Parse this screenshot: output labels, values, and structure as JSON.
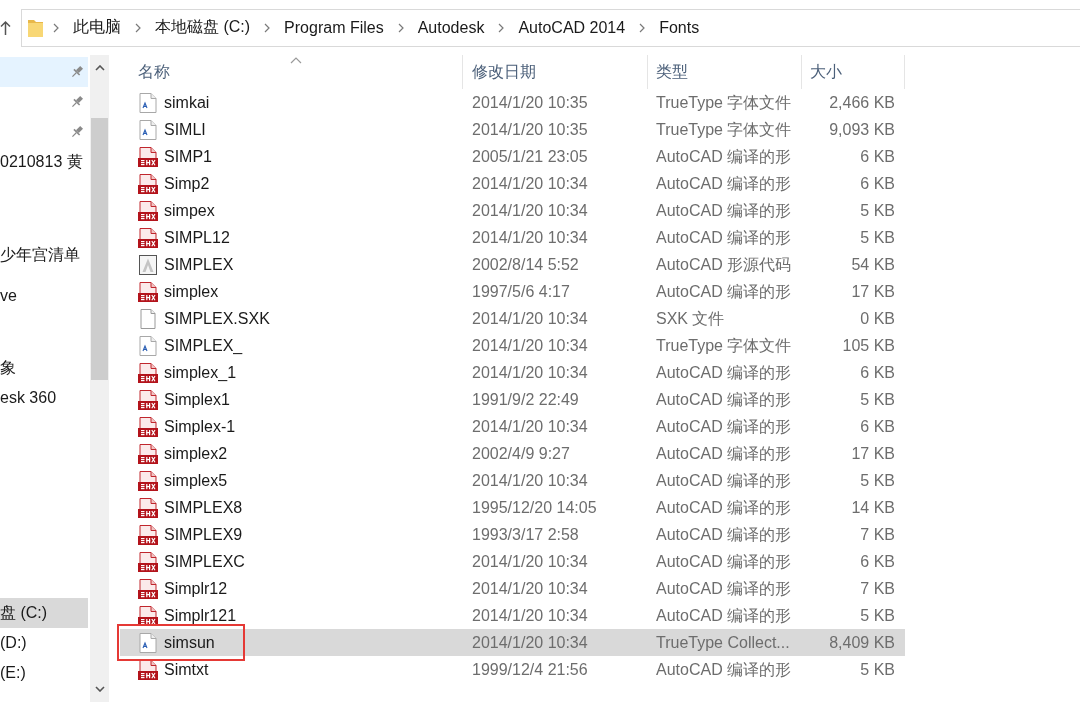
{
  "address_bar": {
    "crumbs": [
      "此电脑",
      "本地磁盘 (C:)",
      "Program Files",
      "Autodesk",
      "AutoCAD 2014",
      "Fonts"
    ]
  },
  "sidebar": {
    "groups": [
      {
        "items": [
          {
            "pinned": true,
            "hovered": true,
            "selected": false
          },
          {
            "pinned": true,
            "hovered": false,
            "selected": false
          },
          {
            "pinned": true,
            "hovered": false,
            "selected": false
          },
          {
            "label": "0210813 黄",
            "pinned": false,
            "hovered": false,
            "selected": false
          }
        ]
      },
      {
        "items": [
          {
            "label": "少年宫清单",
            "pinned": false,
            "hovered": false,
            "selected": false
          }
        ]
      },
      {
        "items": [
          {
            "label": "ve",
            "pinned": false,
            "hovered": false,
            "selected": false
          }
        ]
      },
      {
        "items": [
          {
            "label": "象",
            "pinned": false,
            "hovered": false,
            "selected": false
          },
          {
            "label": "esk 360",
            "pinned": false,
            "hovered": false,
            "selected": false
          }
        ]
      },
      {
        "items": [
          {
            "label": "盘 (C:)",
            "pinned": false,
            "hovered": false,
            "selected": true
          },
          {
            "label": "(D:)",
            "pinned": false,
            "hovered": false,
            "selected": false
          },
          {
            "label": "(E:)",
            "pinned": false,
            "hovered": false,
            "selected": false
          }
        ]
      }
    ]
  },
  "file_list": {
    "columns": [
      {
        "label": "名称",
        "sorted": true
      },
      {
        "label": "修改日期",
        "sorted": false
      },
      {
        "label": "类型",
        "sorted": false
      },
      {
        "label": "大小",
        "sorted": false
      }
    ],
    "rows": [
      {
        "name": "simkai",
        "modified": "2014/1/20 10:35",
        "type": "TrueType 字体文件",
        "size": "2,466 KB",
        "kind": "font",
        "selected": false,
        "outlined": false
      },
      {
        "name": "SIMLI",
        "modified": "2014/1/20 10:35",
        "type": "TrueType 字体文件",
        "size": "9,093 KB",
        "kind": "font",
        "selected": false,
        "outlined": false
      },
      {
        "name": "SIMP1",
        "modified": "2005/1/21 23:05",
        "type": "AutoCAD 编译的形",
        "size": "6 KB",
        "kind": "shx",
        "selected": false,
        "outlined": false
      },
      {
        "name": "Simp2",
        "modified": "2014/1/20 10:34",
        "type": "AutoCAD 编译的形",
        "size": "6 KB",
        "kind": "shx",
        "selected": false,
        "outlined": false
      },
      {
        "name": "simpex",
        "modified": "2014/1/20 10:34",
        "type": "AutoCAD 编译的形",
        "size": "5 KB",
        "kind": "shx",
        "selected": false,
        "outlined": false
      },
      {
        "name": "SIMPL12",
        "modified": "2014/1/20 10:34",
        "type": "AutoCAD 编译的形",
        "size": "5 KB",
        "kind": "shx",
        "selected": false,
        "outlined": false
      },
      {
        "name": "SIMPLEX",
        "modified": "2002/8/14 5:52",
        "type": "AutoCAD 形源代码",
        "size": "54 KB",
        "kind": "source",
        "selected": false,
        "outlined": false
      },
      {
        "name": "simplex",
        "modified": "1997/5/6 4:17",
        "type": "AutoCAD 编译的形",
        "size": "17 KB",
        "kind": "shx",
        "selected": false,
        "outlined": false
      },
      {
        "name": "SIMPLEX.SXK",
        "modified": "2014/1/20 10:34",
        "type": "SXK 文件",
        "size": "0 KB",
        "kind": "file",
        "selected": false,
        "outlined": false
      },
      {
        "name": "SIMPLEX_",
        "modified": "2014/1/20 10:34",
        "type": "TrueType 字体文件",
        "size": "105 KB",
        "kind": "font",
        "selected": false,
        "outlined": false
      },
      {
        "name": "simplex_1",
        "modified": "2014/1/20 10:34",
        "type": "AutoCAD 编译的形",
        "size": "6 KB",
        "kind": "shx",
        "selected": false,
        "outlined": false
      },
      {
        "name": "Simplex1",
        "modified": "1991/9/2 22:49",
        "type": "AutoCAD 编译的形",
        "size": "5 KB",
        "kind": "shx",
        "selected": false,
        "outlined": false
      },
      {
        "name": "Simplex-1",
        "modified": "2014/1/20 10:34",
        "type": "AutoCAD 编译的形",
        "size": "6 KB",
        "kind": "shx",
        "selected": false,
        "outlined": false
      },
      {
        "name": "simplex2",
        "modified": "2002/4/9 9:27",
        "type": "AutoCAD 编译的形",
        "size": "17 KB",
        "kind": "shx",
        "selected": false,
        "outlined": false
      },
      {
        "name": "simplex5",
        "modified": "2014/1/20 10:34",
        "type": "AutoCAD 编译的形",
        "size": "5 KB",
        "kind": "shx",
        "selected": false,
        "outlined": false
      },
      {
        "name": "SIMPLEX8",
        "modified": "1995/12/20 14:05",
        "type": "AutoCAD 编译的形",
        "size": "14 KB",
        "kind": "shx",
        "selected": false,
        "outlined": false
      },
      {
        "name": "SIMPLEX9",
        "modified": "1993/3/17 2:58",
        "type": "AutoCAD 编译的形",
        "size": "7 KB",
        "kind": "shx",
        "selected": false,
        "outlined": false
      },
      {
        "name": "SIMPLEXC",
        "modified": "2014/1/20 10:34",
        "type": "AutoCAD 编译的形",
        "size": "6 KB",
        "kind": "shx",
        "selected": false,
        "outlined": false
      },
      {
        "name": "Simplr12",
        "modified": "2014/1/20 10:34",
        "type": "AutoCAD 编译的形",
        "size": "7 KB",
        "kind": "shx",
        "selected": false,
        "outlined": false
      },
      {
        "name": "Simplr121",
        "modified": "2014/1/20 10:34",
        "type": "AutoCAD 编译的形",
        "size": "5 KB",
        "kind": "shx",
        "selected": false,
        "outlined": false
      },
      {
        "name": "simsun",
        "modified": "2014/1/20 10:34",
        "type": "TrueType Collect...",
        "size": "8,409 KB",
        "kind": "font",
        "selected": true,
        "outlined": true
      },
      {
        "name": "Simtxt",
        "modified": "1999/12/4 21:56",
        "type": "AutoCAD 编译的形",
        "size": "5 KB",
        "kind": "shx",
        "selected": false,
        "outlined": false
      }
    ]
  }
}
